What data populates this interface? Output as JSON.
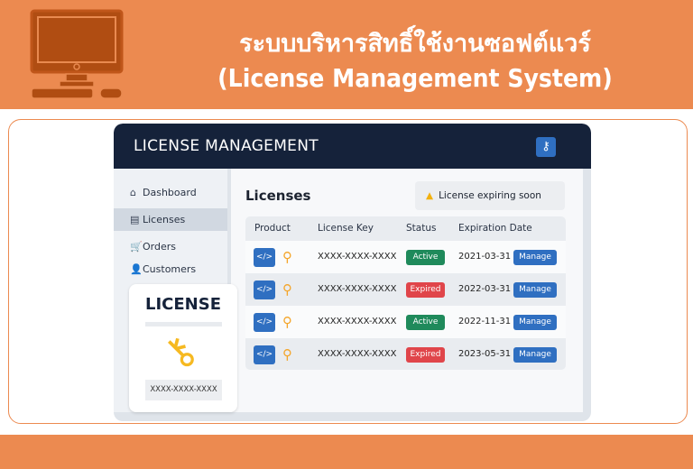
{
  "banner": {
    "title_thai": "ระบบบริหารสิทธิ์ใช้งานซอฟต์แวร์",
    "title_en": "(License Management System)",
    "icon": "desktop-computer-icon",
    "color": "#ec8a50"
  },
  "app": {
    "title": "LICENSE MANAGEMENT",
    "header_icon": "key-icon",
    "sidebar": [
      {
        "label": "Dashboard",
        "icon": "home-icon"
      },
      {
        "label": "Licenses",
        "icon": "list-icon",
        "active": true
      },
      {
        "label": "Orders",
        "icon": "cart-icon"
      },
      {
        "label": "Customers",
        "icon": "user-icon"
      }
    ],
    "page_title": "Licenses",
    "alert": "License expiring soon",
    "columns": [
      "Product",
      "License Key",
      "Status",
      "Expiration Date"
    ],
    "rows": [
      {
        "key": "XXXX-XXXX-XXXX",
        "status": "Active",
        "date": "2021-03-31",
        "action": "Manage"
      },
      {
        "key": "XXXX-XXXX-XXXX",
        "status": "Expired",
        "date": "2022-03-31",
        "action": "Manage"
      },
      {
        "key": "XXXX-XXXX-XXXX",
        "status": "Active",
        "date": "2022-11-31",
        "action": "Manage"
      },
      {
        "key": "XXXX-XXXX-XXXX",
        "status": "Expired",
        "date": "2023-05-31",
        "action": "Manage"
      }
    ],
    "card": {
      "title": "LICENSE",
      "key": "XXXX-XXXX-XXXX"
    },
    "colors": {
      "active": "#1f8a5b",
      "expired": "#e0454a",
      "primary": "#2f6fc1",
      "header": "#15223a"
    }
  }
}
